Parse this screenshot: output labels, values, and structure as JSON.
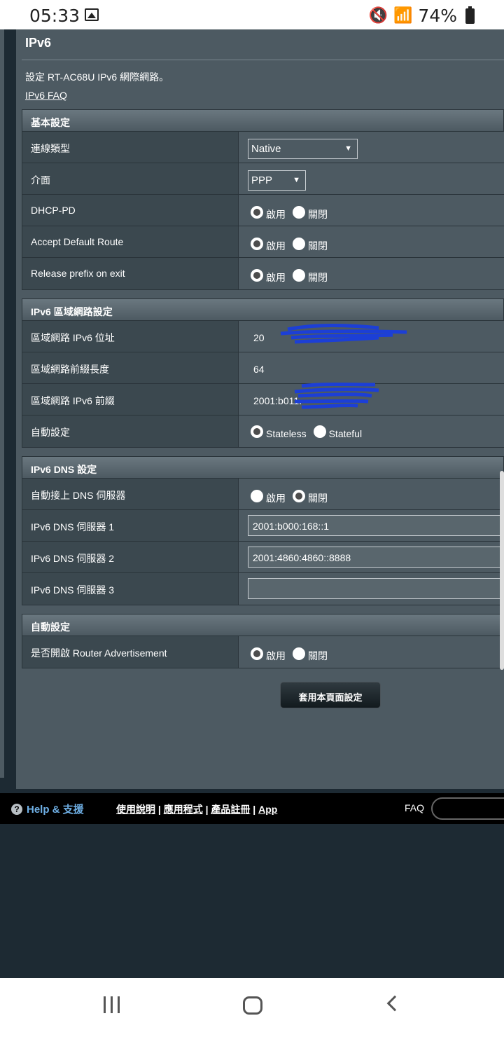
{
  "status_bar": {
    "time": "05:33",
    "battery": "74%"
  },
  "page": {
    "title": "IPv6",
    "description": "設定 RT-AC68U IPv6 網際網路。",
    "faq_link": "IPv6 FAQ"
  },
  "basic": {
    "header": "基本設定",
    "conn_type_label": "連線類型",
    "conn_type_value": "Native",
    "interface_label": "介面",
    "interface_value": "PPP",
    "dhcp_pd_label": "DHCP-PD",
    "accept_route_label": "Accept Default Route",
    "release_prefix_label": "Release prefix on exit",
    "enable": "啟用",
    "disable": "關閉"
  },
  "lan": {
    "header": "IPv6 區域網路設定",
    "addr_label": "區域網路 IPv6 位址",
    "addr_value": "20",
    "prefix_len_label": "區域網路前綴長度",
    "prefix_len_value": "64",
    "prefix_label": "區域網路 IPv6 前綴",
    "prefix_value": "2001:b011.",
    "autoconf_label": "自動設定",
    "stateless": "Stateless",
    "stateful": "Stateful"
  },
  "dns": {
    "header": "IPv6 DNS 設定",
    "auto_label": "自動接上 DNS 伺服器",
    "server1_label": "IPv6 DNS 伺服器 1",
    "server1_value": "2001:b000:168::1",
    "server2_label": "IPv6 DNS 伺服器 2",
    "server2_value": "2001:4860:4860::8888",
    "server3_label": "IPv6 DNS 伺服器 3",
    "server3_value": ""
  },
  "auto": {
    "header": "自動設定",
    "ra_label": "是否開啟 Router Advertisement"
  },
  "apply_button": "套用本頁面設定",
  "footer": {
    "help": "Help & 支援",
    "link1": "使用說明",
    "link2": "應用程式",
    "link3": "產品註冊",
    "link4": "App",
    "separator": " | ",
    "faq": "FAQ"
  },
  "colors": {
    "panel": "#4d5a62",
    "label_cell": "#3b484f",
    "help_link": "#6fb0e6",
    "scribble": "#1c3fd6"
  }
}
